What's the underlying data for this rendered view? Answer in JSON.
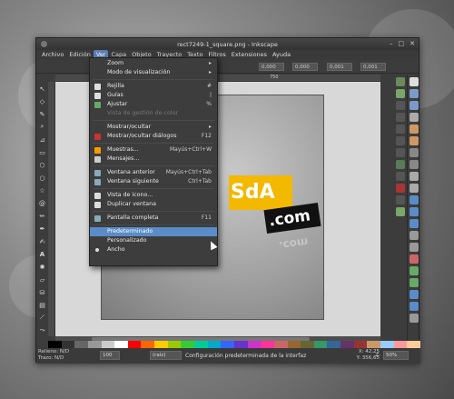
{
  "window": {
    "title": "rect7249-1_square.png - Inkscape"
  },
  "menubar": {
    "items": [
      "Archivo",
      "Edición",
      "Ver",
      "Capa",
      "Objeto",
      "Trayecto",
      "Texto",
      "Filtros",
      "Extensiones",
      "Ayuda"
    ],
    "active_index": 2
  },
  "ruler": {
    "label": "750"
  },
  "ver_menu": {
    "items": [
      {
        "label": "Zoom",
        "accel": "▸",
        "icon": "none",
        "disabled": false
      },
      {
        "label": "Modo de visualización",
        "accel": "▸",
        "icon": "none",
        "disabled": false
      },
      {
        "label": "Rejilla",
        "accel": "#",
        "icon": "grid-icon",
        "disabled": false
      },
      {
        "label": "Guías",
        "accel": "|",
        "icon": "guides-icon",
        "disabled": false
      },
      {
        "label": "Ajustar",
        "accel": "%",
        "icon": "snap-icon",
        "disabled": false
      },
      {
        "label": "Vista de gestión de color",
        "accel": "",
        "icon": "none",
        "disabled": true
      },
      {
        "label": "Mostrar/ocultar",
        "accel": "▸",
        "icon": "none",
        "disabled": false
      },
      {
        "label": "Mostrar/ocultar diálogos",
        "accel": "F12",
        "icon": "dialogs-icon",
        "disabled": false
      },
      {
        "label": "Muestras...",
        "accel": "Mayús+Ctrl+W",
        "icon": "swatches-icon",
        "disabled": false
      },
      {
        "label": "Mensajes...",
        "accel": "",
        "icon": "messages-icon",
        "disabled": false
      },
      {
        "label": "Ventana anterior",
        "accel": "Mayús+Ctrl+Tab",
        "icon": "prev-window-icon",
        "disabled": false
      },
      {
        "label": "Ventana siguiente",
        "accel": "Ctrl+Tab",
        "icon": "next-window-icon",
        "disabled": false
      },
      {
        "label": "Vista de icono...",
        "accel": "",
        "icon": "icon-view-icon",
        "disabled": false
      },
      {
        "label": "Duplicar ventana",
        "accel": "",
        "icon": "duplicate-window-icon",
        "disabled": false
      },
      {
        "label": "Pantalla completa",
        "accel": "F11",
        "icon": "fullscreen-icon",
        "disabled": false
      },
      {
        "label": "Predeterminado",
        "accel": "",
        "icon": "none",
        "disabled": false
      },
      {
        "label": "Personalizado",
        "accel": "",
        "icon": "none",
        "disabled": false
      },
      {
        "label": "Ancho",
        "accel": "",
        "icon": "radio-icon",
        "disabled": false
      }
    ],
    "selected_label": "Predeterminado"
  },
  "canvas": {
    "logo_text": "SdA",
    "logo_com": ".com",
    "logo_reflection": ".com"
  },
  "statusbar": {
    "fill_label": "Relleno:",
    "stroke_label": "Trazo:",
    "fill_value": "N/D",
    "stroke_value": "N/D",
    "opacity_value": "100",
    "layer": "(raíz)",
    "message": "Configuración predeterminada de la interfaz",
    "x_label": "X:",
    "x_value": "42,25",
    "y_label": "Y:",
    "y_value": "356,65",
    "zoom_label": "Z:",
    "zoom_value": "50%"
  },
  "colors": {
    "accent": "#5a8cc8",
    "logo_yellow": "#f3b800",
    "menu_bg": "#3d3d3d",
    "palette": [
      "#000000",
      "#333333",
      "#666666",
      "#999999",
      "#cccccc",
      "#ffffff",
      "#ff0000",
      "#ff6600",
      "#ffcc00",
      "#99cc00",
      "#33cc33",
      "#00cc99",
      "#00aacc",
      "#3366ff",
      "#6633cc",
      "#cc33cc",
      "#ff3399",
      "#cc6666",
      "#996633",
      "#666633",
      "#339966",
      "#336699",
      "#663366",
      "#993333",
      "#cc9966",
      "#99ccff",
      "#ff9999",
      "#ffcc99"
    ]
  }
}
